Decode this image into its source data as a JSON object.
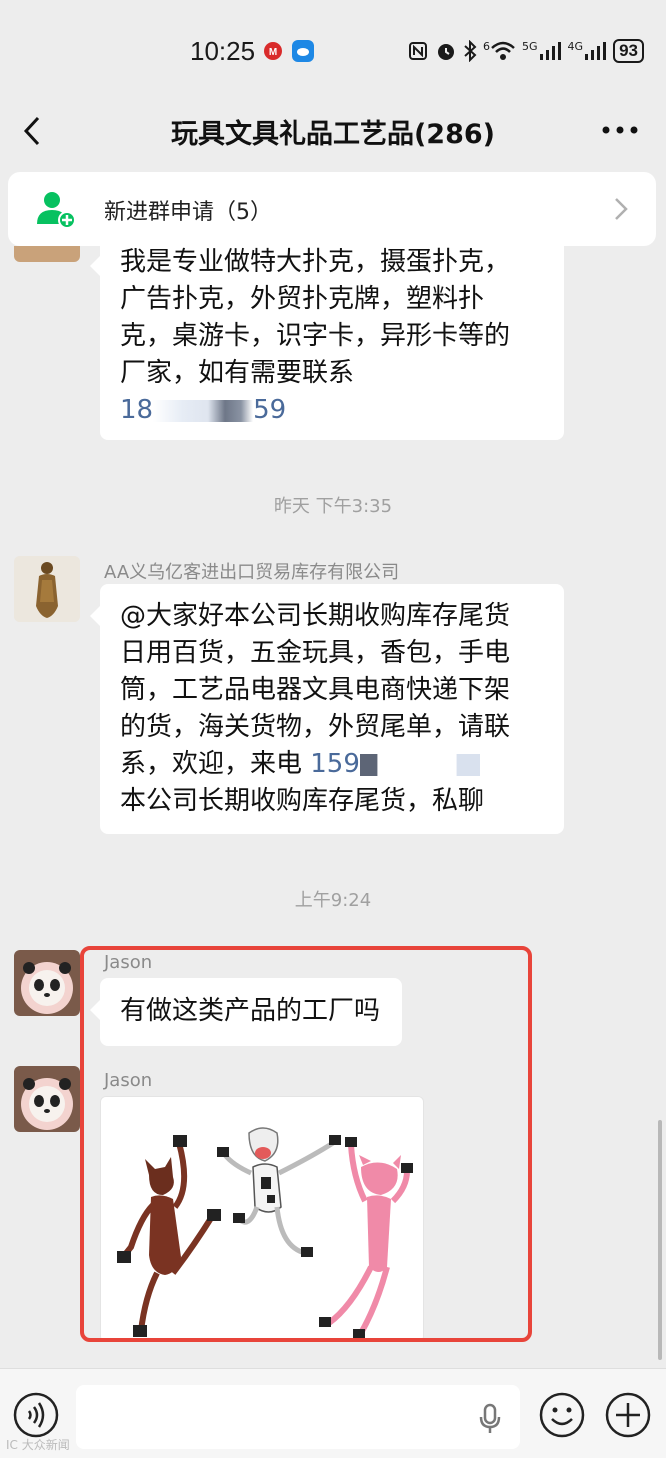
{
  "status_bar": {
    "time": "10:25",
    "battery": "93",
    "signal_5g": "5G",
    "signal_4g": "4G",
    "wifi_label": "6"
  },
  "header": {
    "title": "玩具文具礼品工艺品(286)",
    "back_icon": "chevron-left-icon",
    "more_icon": "more-dots-icon"
  },
  "join_banner": {
    "label": "新进群申请（5）",
    "icon": "add-user-icon"
  },
  "messages": {
    "msg1": {
      "lines": [
        "我是专业做特大扑克，摄蛋扑克，",
        "广告扑克，外贸扑克牌，塑料扑",
        "克，桌游卡，识字卡，异形卡等的",
        "厂家，如有需要联系"
      ],
      "phone_prefix": "18",
      "phone_suffix": "59"
    },
    "time1": "昨天 下午3:35",
    "msg2": {
      "sender": "AA义乌亿客进出口贸易库存有限公司",
      "lines": [
        "@大家好本公司长期收购库存尾货",
        "日用百货，五金玩具，香包，手电",
        "筒，工艺品电器文具电商快递下架",
        "的货，海关货物，外贸尾单，请联"
      ],
      "line5_text": "系，欢迎，来电 ",
      "line5_phone": "159",
      "line6": "本公司长期收购库存尾货，私聊"
    },
    "time2": "上午9:24",
    "msg3": {
      "sender": "Jason",
      "text": "有做这类产品的工厂吗"
    },
    "msg4": {
      "sender": "Jason"
    }
  },
  "input_bar": {
    "placeholder": "",
    "voice_icon": "voice-icon",
    "mic_icon": "mic-icon",
    "emoji_icon": "emoji-icon",
    "plus_icon": "plus-icon"
  },
  "watermark": "IC 大众新闻",
  "colors": {
    "background": "#ededed",
    "bubble": "#ffffff",
    "highlight": "#e8443a",
    "link": "#4a6a9a",
    "wechat_green": "#07c160"
  }
}
